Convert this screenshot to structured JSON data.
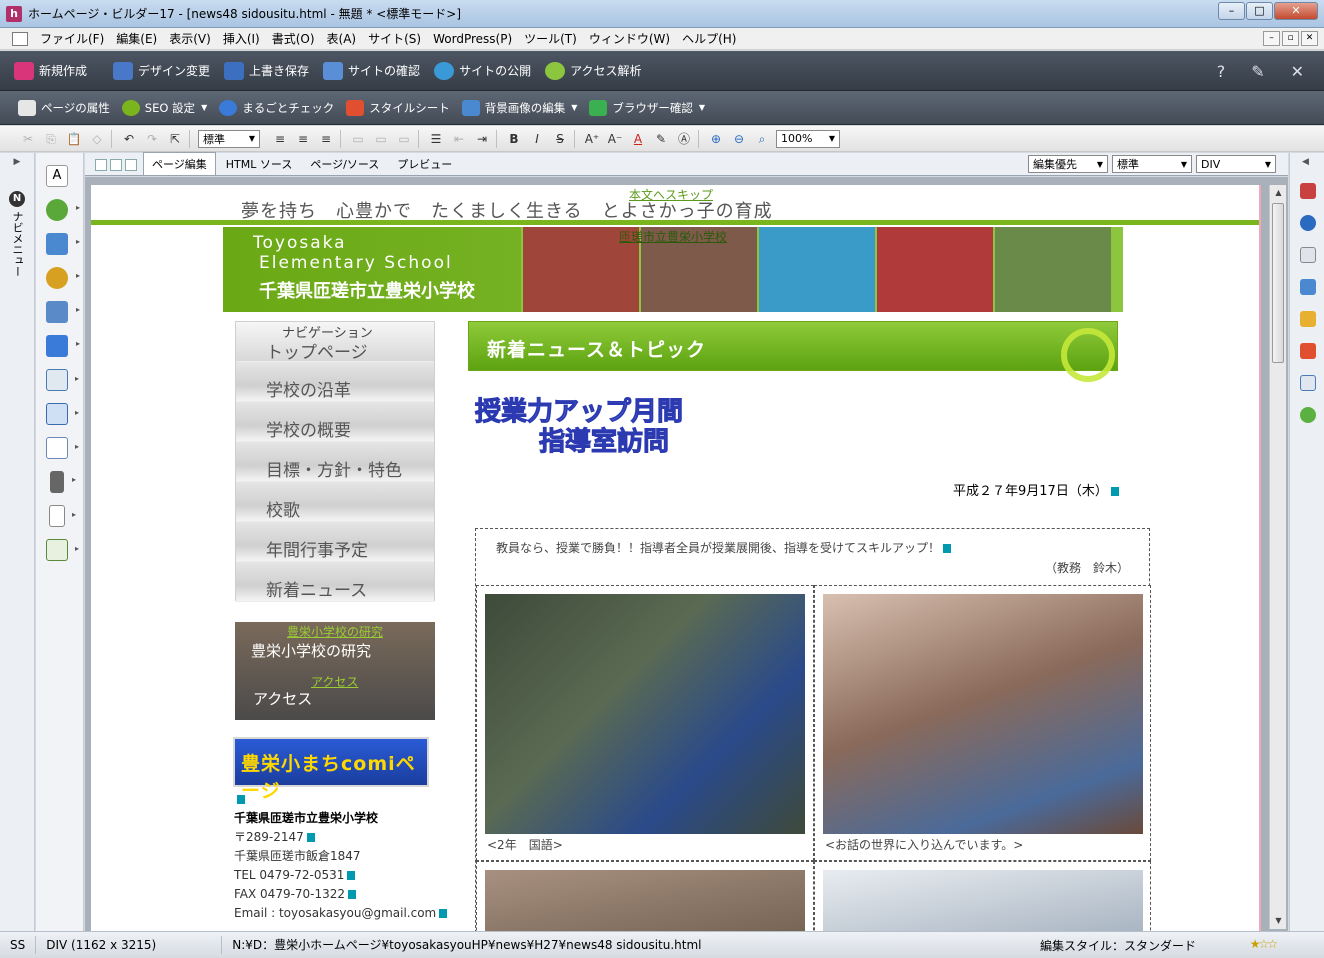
{
  "window": {
    "title": "ホームページ・ビルダー17 - [news48 sidousitu.html - 無題 * <標準モード>]",
    "app_icon_letter": "h",
    "controls": [
      "–",
      "□",
      "✕"
    ],
    "mdi_controls": [
      "–",
      "▫",
      "✕"
    ]
  },
  "menubar": [
    "ファイル(F)",
    "編集(E)",
    "表示(V)",
    "挿入(I)",
    "書式(O)",
    "表(A)",
    "サイト(S)",
    "WordPress(P)",
    "ツール(T)",
    "ウィンドウ(W)",
    "ヘルプ(H)"
  ],
  "toolbar_main": [
    {
      "label": "新規作成",
      "color": "#d8357a"
    },
    {
      "label": "デザイン変更",
      "color": "#4a78c8"
    },
    {
      "label": "上書き保存",
      "color": "#3c6fc0"
    },
    {
      "label": "サイトの確認",
      "color": "#5a8fd8"
    },
    {
      "label": "サイトの公開",
      "color": "#3a9ad8"
    },
    {
      "label": "アクセス解析",
      "color": "#8cc63f"
    }
  ],
  "toolbar_main_right": [
    "?",
    "✎",
    "✕"
  ],
  "toolbar_sub": [
    {
      "label": "ページの属性",
      "color": "#e6e6e6",
      "drop": false
    },
    {
      "label": "SEO 設定",
      "color": "#7ab51d",
      "drop": true
    },
    {
      "label": "まるごとチェック",
      "color": "#3a7ad8",
      "drop": false
    },
    {
      "label": "スタイルシート",
      "color": "#e05030",
      "drop": false
    },
    {
      "label": "背景画像の編集",
      "color": "#4a88d0",
      "drop": true
    },
    {
      "label": "ブラウザー確認",
      "color": "#3ab050",
      "drop": true
    }
  ],
  "format_toolbar": {
    "style_select": "標準",
    "zoom_select": "100%",
    "buttons": [
      "✂",
      "⎘",
      "📋",
      "◇",
      "↶",
      "↷",
      "⇱",
      "≡",
      "≡",
      "≡",
      "B",
      "I",
      "S",
      "A⁺",
      "A⁻",
      "A",
      "⊕",
      "⊖",
      "⌕"
    ]
  },
  "left_nav": {
    "label": "ナビメニュー",
    "badge": "N"
  },
  "tool_icons": [
    "text-tool-icon",
    "people-icon",
    "font-icon",
    "link-icon",
    "image-icon",
    "shape-icon",
    "layout-icon",
    "table-icon",
    "list-icon",
    "mobile-icon",
    "page-icon",
    "calendar-icon"
  ],
  "editor_tabs": {
    "tabs": [
      "ページ編集",
      "HTML ソース",
      "ページ/ソース",
      "プレビュー"
    ],
    "active": 0,
    "right_selects": [
      "編集優先",
      "標準",
      "DIV"
    ]
  },
  "page": {
    "skip_link": "本文へスキップ",
    "motto": "夢を持ち　心豊かで　たくましく生きる　とよさかっ子の育成",
    "banner": {
      "en_line1": "Toyosaka",
      "en_line2": "Elementary School",
      "jp_name": "千葉県匝瑳市立豊栄小学校",
      "overlay_link": "匝瑳市立豊栄小学校",
      "photo_colors": [
        "#a0453a",
        "#7e5a4a",
        "#3a9ac8",
        "#b03a3a",
        "#6a8a4a"
      ]
    },
    "nav": {
      "caption": "ナビゲーション",
      "items": [
        "トップページ",
        "学校の沿革",
        "学校の概要",
        "目標・方針・特色",
        "校歌",
        "年間行事予定",
        "新着ニュース"
      ]
    },
    "research": {
      "small": "豊栄小学校の研究",
      "main": "豊栄小学校の研究",
      "access_small": "アクセス",
      "access_main": "アクセス"
    },
    "machi_banner": "豊栄小まちcomiページ",
    "school": {
      "name": "千葉県匝瑳市立豊栄小学校",
      "postal": "〒289-2147",
      "address": "千葉県匝瑳市飯倉1847",
      "tel": "TEL 0479-72-0531",
      "fax": "FAX 0479-70-1322",
      "email": "Email : toyosakasyou@gmail.com"
    },
    "news_header": "新着ニュース＆トピック",
    "article_title_1": "授業力アップ月間",
    "article_title_2": "指導室訪問",
    "date": "平成２７年9月17日（木）",
    "intro": "教員なら、授業で勝負！！指導者全員が授業展開後、指導を受けてスキルアップ！",
    "signature": "（教務　鈴木）",
    "photos": [
      {
        "caption": "<2年　国語>",
        "color": "#3e4a3a"
      },
      {
        "caption": "<お話の世界に入り込んでいます。>",
        "color": "#8a6a5a"
      },
      {
        "caption": "",
        "color": "#6a5a4a"
      },
      {
        "caption": "",
        "color": "#c8d0d8"
      }
    ]
  },
  "statusbar": {
    "mode": "SS",
    "element": "DIV (1162 x 3215)",
    "path": "N:¥D：豊栄小ホームページ¥toyosakasyouHP¥news¥H27¥news48 sidousitu.html",
    "style": "編集スタイル：スタンダード",
    "stars": "★☆☆"
  },
  "right_icons": [
    "layer-icon",
    "word-icon",
    "copy-icon",
    "sitemap-icon",
    "folder-icon",
    "style-icon",
    "code-icon",
    "color-icon"
  ]
}
